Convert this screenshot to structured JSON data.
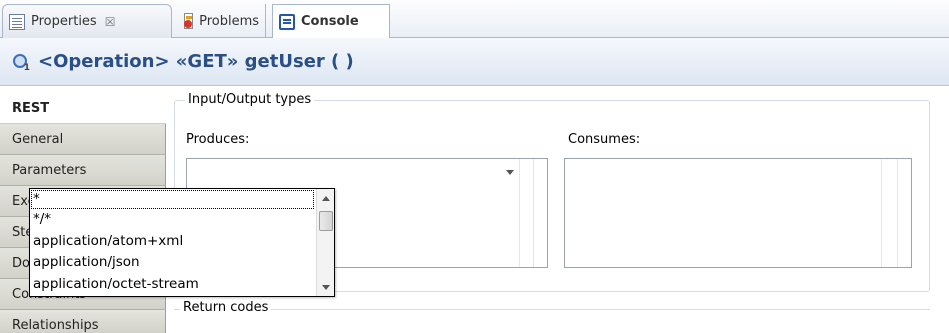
{
  "tabs": [
    {
      "label": "Properties",
      "close": "☒"
    },
    {
      "label": "Problems"
    },
    {
      "label": "Console"
    }
  ],
  "header": {
    "title": "<Operation> «GET» getUser ( )"
  },
  "nav": {
    "items": [
      {
        "label": "REST"
      },
      {
        "label": "General"
      },
      {
        "label": "Parameters"
      },
      {
        "label": "Exceptions"
      },
      {
        "label": "Stereotypes"
      },
      {
        "label": "Documentation"
      },
      {
        "label": "Constraints"
      },
      {
        "label": "Relationships"
      }
    ]
  },
  "io": {
    "group_title": "Input/Output types",
    "produces_label": "Produces:",
    "consumes_label": "Consumes:",
    "combo_value": ""
  },
  "dropdown": {
    "options": [
      "*",
      "*/*",
      "application/atom+xml",
      "application/json",
      "application/octet-stream"
    ]
  },
  "return_codes": {
    "title": "Return codes"
  }
}
